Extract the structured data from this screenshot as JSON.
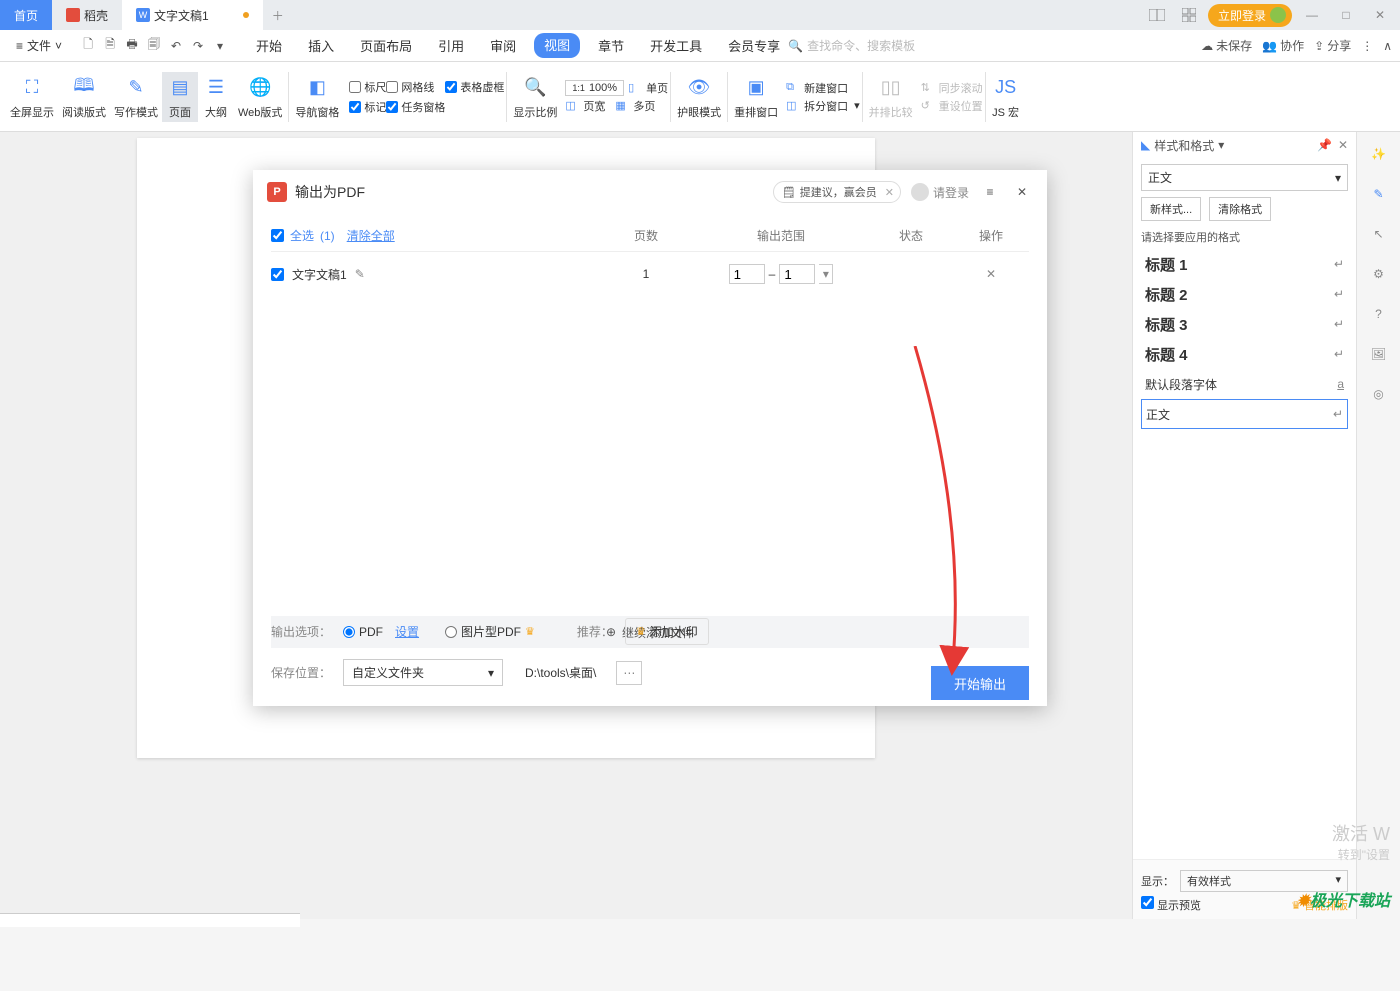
{
  "titlebar": {
    "home": "首页",
    "docker": "稻壳",
    "doc": "文字文稿1",
    "login": "立即登录"
  },
  "menubar": {
    "file": "文件",
    "tabs": [
      "开始",
      "插入",
      "页面布局",
      "引用",
      "审阅",
      "视图",
      "章节",
      "开发工具",
      "会员专享"
    ],
    "search_placeholder": "查找命令、搜索模板",
    "unsaved": "未保存",
    "collab": "协作",
    "share": "分享"
  },
  "ribbon": {
    "fullscreen": "全屏显示",
    "read": "阅读版式",
    "write": "写作模式",
    "page": "页面",
    "outline": "大纲",
    "web": "Web版式",
    "nav": "导航窗格",
    "ruler": "标尺",
    "grid": "网格线",
    "vruler": "表格虚框",
    "mark": "标记",
    "task": "任务窗格",
    "scale": "显示比例",
    "zoom": "100%",
    "single": "单页",
    "width": "页宽",
    "multi": "多页",
    "eye": "护眼模式",
    "rearr": "重排窗口",
    "newwin": "新建窗口",
    "split": "拆分窗口",
    "compare": "并排比较",
    "sync": "同步滚动",
    "reset": "重设位置",
    "jsmacro": "JS 宏"
  },
  "dialog": {
    "title": "输出为PDF",
    "suggest": "提建议，赢会员",
    "login": "请登录",
    "select_all": "全选",
    "sel_count": "(1)",
    "clear_all": "清除全部",
    "col_pages": "页数",
    "col_range": "输出范围",
    "col_status": "状态",
    "col_action": "操作",
    "row_name": "文字文稿1",
    "row_pages": "1",
    "range_from": "1",
    "range_to": "1",
    "add_more": "继续添加文件",
    "out_opt": "输出选项：",
    "pdf": "PDF",
    "settings": "设置",
    "img_pdf": "图片型PDF",
    "recommend": "推荐：",
    "watermark": "添加水印",
    "save_loc": "保存位置：",
    "save_sel": "自定义文件夹",
    "save_path": "D:\\tools\\桌面\\",
    "start": "开始输出"
  },
  "side": {
    "title": "样式和格式",
    "current": "正文",
    "new_style": "新样式...",
    "clear": "清除格式",
    "hint": "请选择要应用的格式",
    "h1": "标题 1",
    "h2": "标题 2",
    "h3": "标题 3",
    "h4": "标题 4",
    "default_font": "默认段落字体",
    "body": "正文",
    "display": "显示：",
    "display_val": "有效样式",
    "preview": "显示预览",
    "smart": "智能排版"
  },
  "watermark": {
    "activate": "激活 W",
    "goto": "转到\"设置"
  },
  "logo": "极光下载站"
}
